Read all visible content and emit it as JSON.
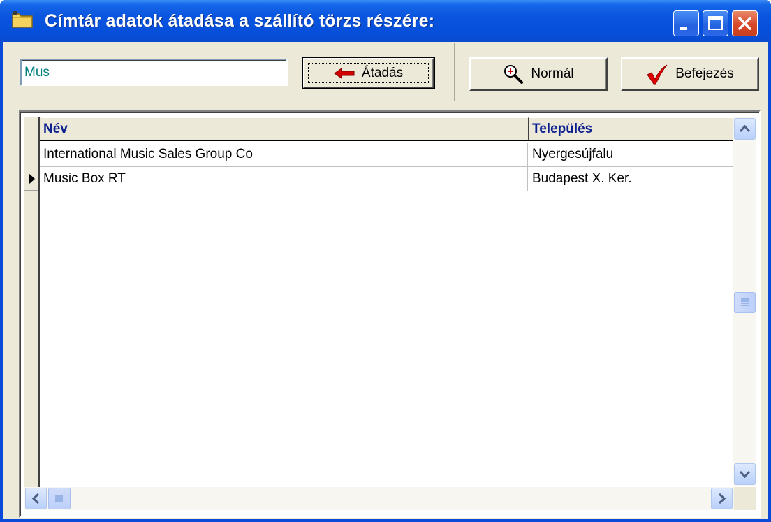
{
  "window": {
    "title": "Címtár adatok átadása a szállító törzs részére:",
    "title_icon": "folder-icon",
    "controls": [
      "minimize-icon",
      "maximize-icon",
      "close-icon"
    ]
  },
  "toolbar": {
    "search_value": "Mus",
    "transfer_label": "Átadás",
    "transfer_icon": "red-arrow-left-icon",
    "normal_label": "Normál",
    "normal_icon": "magnifier-icon",
    "finish_label": "Befejezés",
    "finish_icon": "checkmark-icon"
  },
  "grid": {
    "columns": [
      "Név",
      "Település"
    ],
    "rows": [
      {
        "name": "International Music Sales Group Co",
        "town": "Nyergesújfalu",
        "current": false
      },
      {
        "name": "Music Box RT",
        "town": "Budapest X. Ker.",
        "current": true
      }
    ]
  },
  "colors": {
    "title_bar": "#0a55df",
    "header_text": "#0b1f8f",
    "input_text": "#008080",
    "arrow": "#d40000",
    "check": "#e00000"
  }
}
